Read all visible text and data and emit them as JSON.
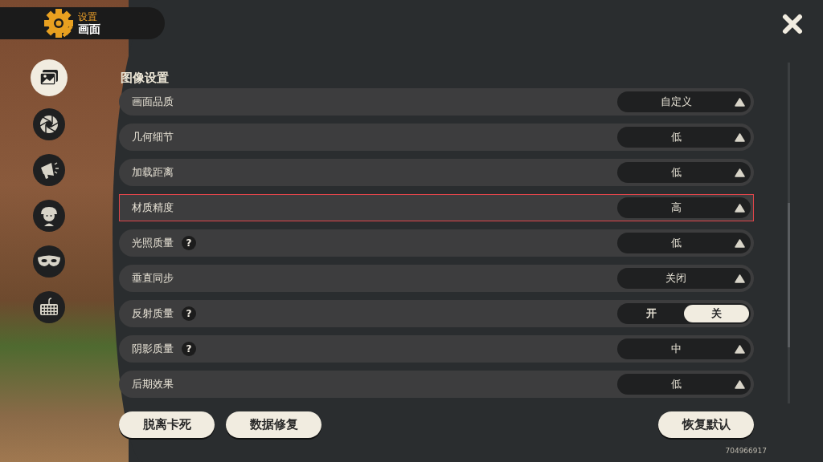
{
  "header": {
    "category": "设置",
    "page": "画面"
  },
  "nav": [
    {
      "kind": "picture",
      "selected": true
    },
    {
      "kind": "aperture",
      "selected": false
    },
    {
      "kind": "megaphone",
      "selected": false
    },
    {
      "kind": "character",
      "selected": false
    },
    {
      "kind": "mask",
      "selected": false
    },
    {
      "kind": "keyboard",
      "selected": false
    }
  ],
  "section_title": "图像设置",
  "rows": [
    {
      "label": "画面品质",
      "highlighted": false,
      "control": {
        "kind": "dropdown",
        "value": "自定义"
      }
    },
    {
      "label": "几何细节",
      "highlighted": false,
      "control": {
        "kind": "dropdown",
        "value": "低"
      }
    },
    {
      "label": "加载距离",
      "highlighted": false,
      "control": {
        "kind": "dropdown",
        "value": "低"
      }
    },
    {
      "label": "材质精度",
      "highlighted": true,
      "control": {
        "kind": "dropdown",
        "value": "高"
      }
    },
    {
      "label": "光照质量",
      "help": "?",
      "highlighted": false,
      "control": {
        "kind": "dropdown",
        "value": "低"
      }
    },
    {
      "label": "垂直同步",
      "highlighted": false,
      "control": {
        "kind": "dropdown",
        "value": "关闭"
      }
    },
    {
      "label": "反射质量",
      "help": "?",
      "highlighted": false,
      "control": {
        "kind": "toggle",
        "options": [
          {
            "label": "开",
            "selected": false
          },
          {
            "label": "关",
            "selected": true
          }
        ]
      }
    },
    {
      "label": "阴影质量",
      "help": "?",
      "highlighted": false,
      "control": {
        "kind": "dropdown",
        "value": "中"
      }
    },
    {
      "label": "后期效果",
      "highlighted": false,
      "control": {
        "kind": "dropdown",
        "value": "低"
      }
    }
  ],
  "left_buttons": [
    "脱离卡死",
    "数据修复"
  ],
  "right_buttons": [
    "恢复默认"
  ],
  "build_id": "704966917"
}
